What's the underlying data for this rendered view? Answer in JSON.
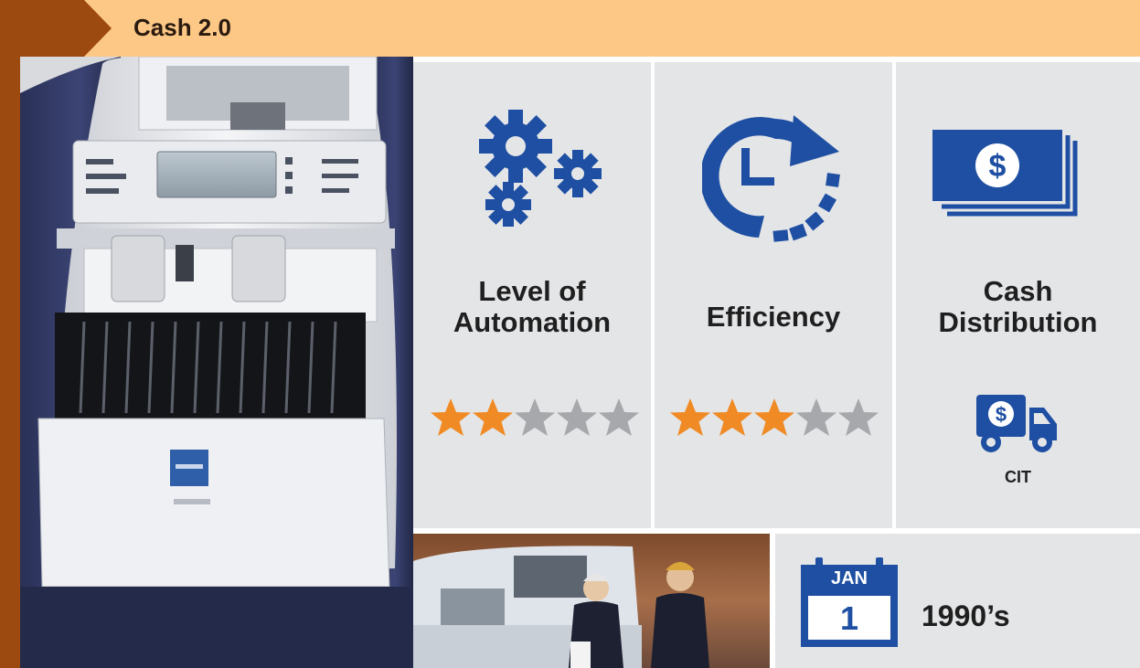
{
  "header": {
    "title": "Cash 2.0"
  },
  "colors": {
    "brand_brown": "#9c4a0f",
    "header_orange": "#fdc886",
    "icon_blue": "#1e4fa2",
    "panel_gray": "#e4e5e7",
    "star_on": "#f08a24",
    "star_off": "#a6a8ab"
  },
  "panels": {
    "automation": {
      "label_line1": "Level of",
      "label_line2": "Automation",
      "icon": "gears-icon",
      "rating": 2,
      "rating_max": 5
    },
    "efficiency": {
      "label": "Efficiency",
      "icon": "clock-refresh-icon",
      "rating": 3,
      "rating_max": 5
    },
    "distribution": {
      "label_line1": "Cash",
      "label_line2": "Distribution",
      "icon": "banknotes-icon",
      "sub_icon": "cash-truck-icon",
      "sub_label": "CIT"
    }
  },
  "date": {
    "month": "JAN",
    "day": "1",
    "decade": "1990’s",
    "icon": "calendar-icon"
  }
}
